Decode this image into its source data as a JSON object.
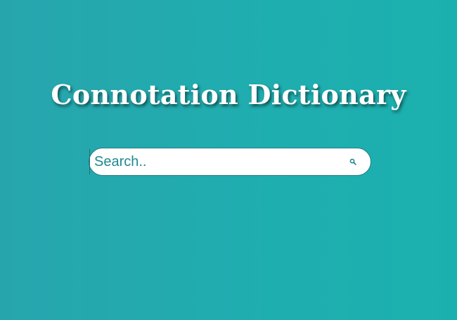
{
  "header": {
    "title": "Connotation Dictionary"
  },
  "search": {
    "placeholder": "Search..",
    "value": "",
    "icon": "search-icon"
  },
  "colors": {
    "background_start": "#27a5ad",
    "background_end": "#1bb0ae",
    "title_text": "#ffffff",
    "search_text": "#1f8a90",
    "search_border": "#1f7f84"
  }
}
